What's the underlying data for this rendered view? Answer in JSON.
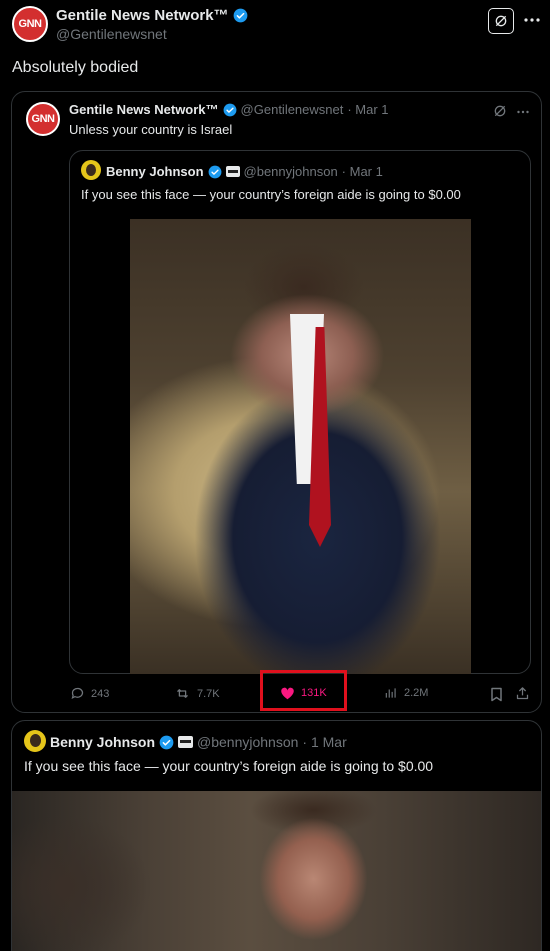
{
  "post": {
    "author_name": "Gentile News Network™",
    "handle": "@Gentilenewsnet",
    "avatar_text": "GNN",
    "text": "Absolutely bodied"
  },
  "quote1": {
    "author_name": "Gentile News Network™",
    "handle": "@Gentilenewsnet",
    "date": "· Mar 1",
    "avatar_text": "GNN",
    "text": "Unless your country is Israel"
  },
  "quote2": {
    "author_name": "Benny Johnson",
    "handle": "@bennyjohnson",
    "date": "· Mar 1",
    "text": "If you see this face — your country’s foreign aide is going to $0.00"
  },
  "actions": {
    "replies": "243",
    "reposts": "7.7K",
    "likes": "131K",
    "views": "2.2M"
  },
  "original": {
    "author_name": "Benny Johnson",
    "handle": "@bennyjohnson",
    "date": "· 1 Mar",
    "text": "If you see this face — your country’s foreign aide is going to $0.00"
  },
  "colors": {
    "background": "#000000",
    "verified": "#1d9bf0",
    "like": "#f91880",
    "highlight_box": "#e0101d",
    "avatar": "#d32f2f"
  },
  "icons": [
    "verified-badge-icon",
    "grok-icon",
    "more-icon",
    "reply-icon",
    "repost-icon",
    "heart-icon",
    "views-icon",
    "bookmark-icon",
    "share-icon",
    "affiliate-badge-icon"
  ]
}
